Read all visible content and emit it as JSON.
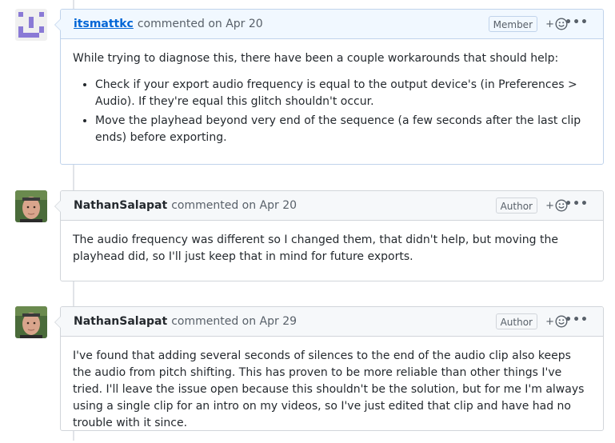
{
  "comments": [
    {
      "author": "itsmattkc",
      "meta": "commented on Apr 20",
      "badge": "Member",
      "react": "+",
      "more": "•••",
      "intro": "While trying to diagnose this, there have been a couple workarounds that should help:",
      "bullets": [
        "Check if your export audio frequency is equal to the output device's (in Preferences > Audio). If they're equal this glitch shouldn't occur.",
        "Move the playhead beyond very end of the sequence (a few seconds after the last clip ends) before exporting."
      ]
    },
    {
      "author": "NathanSalapat",
      "meta": "commented on Apr 20",
      "badge": "Author",
      "react": "+",
      "more": "•••",
      "text": "The audio frequency was different so I changed them, that didn't help, but moving the playhead did, so I'll just keep that in mind for future exports."
    },
    {
      "author": "NathanSalapat",
      "meta": "commented on Apr 29",
      "badge": "Author",
      "react": "+",
      "more": "•••",
      "text": "I've found that adding several seconds of silences to the end of the audio clip also keeps the audio from pitch shifting. This has proven to be more reliable than other things I've tried. I'll leave the issue open because this shouldn't be the solution, but for me I'm always using a single clip for an intro on my videos, so I've just edited that clip and have had no trouble with it since."
    }
  ],
  "icons": {
    "smiley": "smiley-icon",
    "identicon": "identicon-avatar",
    "photo": "photo-avatar"
  },
  "colors": {
    "link": "#0366d6",
    "identicon": "#8a7ad6",
    "member_border": "#c0d3eb",
    "member_header": "#f1f8ff"
  }
}
